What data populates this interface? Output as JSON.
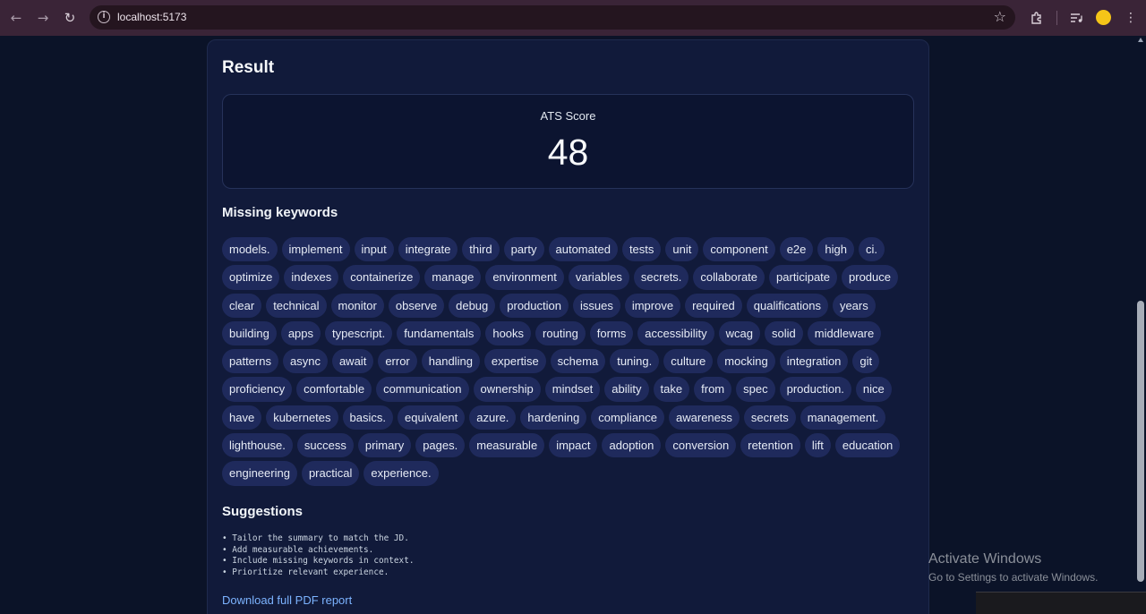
{
  "browser": {
    "url": "localhost:5173"
  },
  "result": {
    "title": "Result",
    "score_label": "ATS Score",
    "score_value": "48"
  },
  "missing_keywords": {
    "title": "Missing keywords",
    "items": [
      "models.",
      "implement",
      "input",
      "integrate",
      "third",
      "party",
      "automated",
      "tests",
      "unit",
      "component",
      "e2e",
      "high",
      "ci.",
      "optimize",
      "indexes",
      "containerize",
      "manage",
      "environment",
      "variables",
      "secrets.",
      "collaborate",
      "participate",
      "produce",
      "clear",
      "technical",
      "monitor",
      "observe",
      "debug",
      "production",
      "issues",
      "improve",
      "required",
      "qualifications",
      "years",
      "building",
      "apps",
      "typescript.",
      "fundamentals",
      "hooks",
      "routing",
      "forms",
      "accessibility",
      "wcag",
      "solid",
      "middleware",
      "patterns",
      "async",
      "await",
      "error",
      "handling",
      "expertise",
      "schema",
      "tuning.",
      "culture",
      "mocking",
      "integration",
      "git",
      "proficiency",
      "comfortable",
      "communication",
      "ownership",
      "mindset",
      "ability",
      "take",
      "from",
      "spec",
      "production.",
      "nice",
      "have",
      "kubernetes",
      "basics.",
      "equivalent",
      "azure.",
      "hardening",
      "compliance",
      "awareness",
      "secrets",
      "management.",
      "lighthouse.",
      "success",
      "primary",
      "pages.",
      "measurable",
      "impact",
      "adoption",
      "conversion",
      "retention",
      "lift",
      "education",
      "engineering",
      "practical",
      "experience."
    ]
  },
  "suggestions": {
    "title": "Suggestions",
    "text": "• Tailor the summary to match the JD.\n• Add measurable achievements.\n• Include missing keywords in context.\n• Prioritize relevant experience."
  },
  "download_label": "Download full PDF report",
  "watermark": {
    "title": "Activate Windows",
    "subtitle": "Go to Settings to activate Windows."
  }
}
